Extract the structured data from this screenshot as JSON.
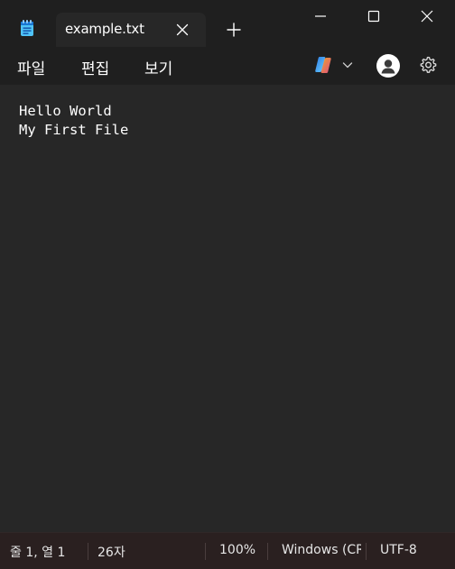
{
  "window": {
    "tab_title": "example.txt"
  },
  "menu": {
    "file": "파일",
    "edit": "편집",
    "view": "보기"
  },
  "editor": {
    "lines": [
      "Hello World",
      "My First File"
    ]
  },
  "status": {
    "position": "줄 1, 열 1",
    "char_count": "26자",
    "zoom": "100%",
    "line_ending": "Windows (CRLF)",
    "encoding": "UTF-8"
  },
  "icons": {
    "app": "notepad-icon",
    "close_tab": "close-icon",
    "new_tab": "plus-icon",
    "minimize": "minimize-icon",
    "maximize": "maximize-icon",
    "close_window": "close-icon",
    "copilot": "copilot-icon",
    "dropdown": "chevron-down-icon",
    "account": "account-icon",
    "settings": "gear-icon"
  },
  "colors": {
    "titlebar": "#1f1f1f",
    "editor_bg": "#272727",
    "statusbar": "#2a2020",
    "text": "#ffffff"
  }
}
